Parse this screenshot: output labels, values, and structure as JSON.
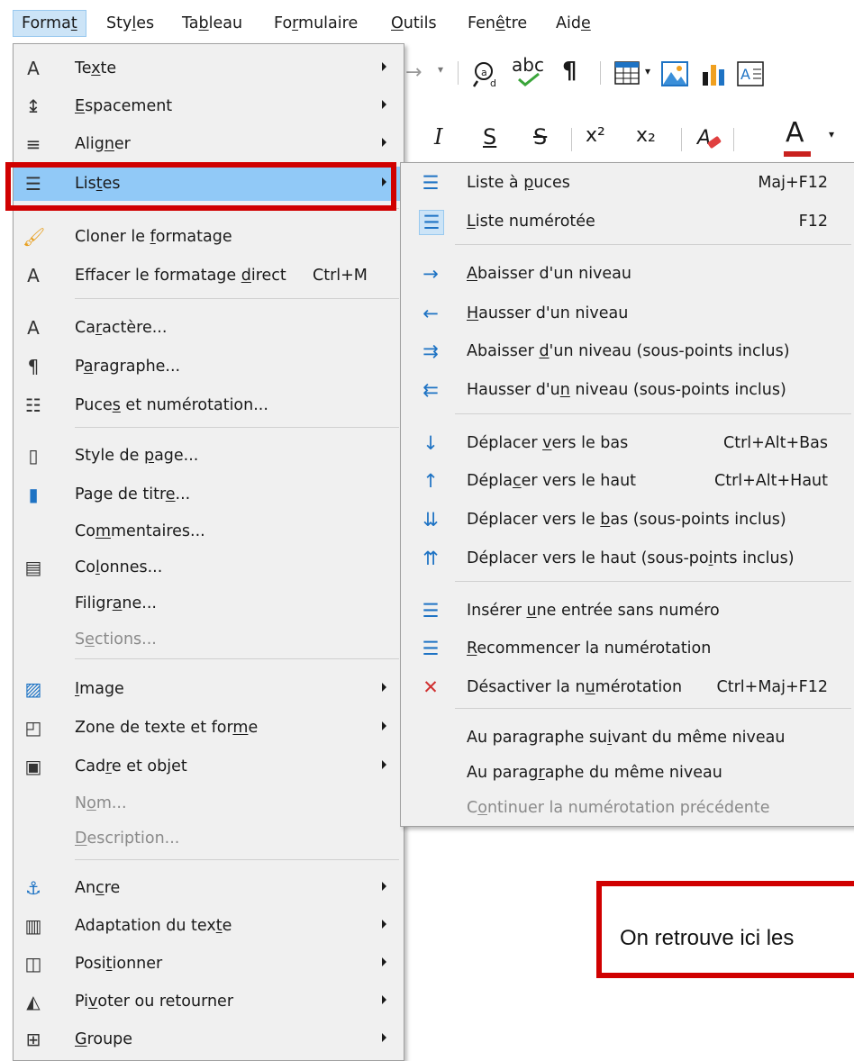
{
  "menubar": {
    "items": [
      {
        "label": "Format",
        "u": 5
      },
      {
        "label": "Styles",
        "u": 3
      },
      {
        "label": "Tableau",
        "u": 2
      },
      {
        "label": "Formulaire",
        "u": 2
      },
      {
        "label": "Outils",
        "u": 0
      },
      {
        "label": "Fenêtre",
        "u": 3
      },
      {
        "label": "Aide",
        "u": 3
      }
    ]
  },
  "toolbar": {
    "row1": [
      "redo-arrow-icon",
      "find-replace-icon",
      "spellcheck-icon",
      "pilcrow-icon",
      "table-icon",
      "image-icon",
      "chart-icon",
      "textbox-icon"
    ],
    "spell_label": "abc",
    "row2": [
      "italic-icon",
      "underline-icon",
      "strikethrough-icon",
      "superscript-icon",
      "subscript-icon",
      "clear-format-icon",
      "font-color-icon"
    ],
    "italic": "I",
    "underline": "S",
    "strike": "S",
    "superscript": "x²",
    "subscript": "x₂",
    "font_color": "A"
  },
  "format_menu": {
    "items": [
      {
        "label": "Texte",
        "u": 2,
        "icon": "text-icon",
        "submenu": true
      },
      {
        "label": "Espacement",
        "u": 0,
        "icon": "spacing-icon",
        "submenu": true
      },
      {
        "label": "Aligner",
        "u": 4,
        "icon": "align-icon",
        "submenu": true
      },
      {
        "label": "Listes",
        "u": 3,
        "icon": "lists-icon",
        "submenu": true,
        "highlighted": true
      },
      {
        "label": "Cloner le formatage",
        "u": 10,
        "icon": "clone-formatting-icon"
      },
      {
        "label": "Effacer le formatage direct",
        "u": 21,
        "icon": "clear-direct-formatting-icon",
        "shortcut": "Ctrl+M"
      },
      {
        "label": "Caractère...",
        "u": 2,
        "icon": "character-icon"
      },
      {
        "label": "Paragraphe...",
        "u": 1,
        "icon": "paragraph-icon"
      },
      {
        "label": "Puces et numérotation...",
        "u": 4,
        "icon": "bullets-numbering-icon"
      },
      {
        "label": "Style de page...",
        "u": 9,
        "icon": "page-style-icon"
      },
      {
        "label": "Page de titre...",
        "u": 12,
        "icon": "title-page-icon"
      },
      {
        "label": "Commentaires...",
        "u": 2,
        "icon": ""
      },
      {
        "label": "Colonnes...",
        "u": 2,
        "icon": "columns-icon"
      },
      {
        "label": "Filigrane...",
        "u": 6,
        "icon": ""
      },
      {
        "label": "Sections...",
        "u": 1,
        "icon": "",
        "disabled": true
      },
      {
        "label": "Image",
        "u": 0,
        "icon": "image-icon",
        "submenu": true
      },
      {
        "label": "Zone de texte et forme",
        "u": 20,
        "icon": "text-box-shape-icon",
        "submenu": true
      },
      {
        "label": "Cadre et objet",
        "u": 3,
        "icon": "frame-object-icon",
        "submenu": true
      },
      {
        "label": "Nom...",
        "u": 1,
        "icon": "",
        "disabled": true
      },
      {
        "label": "Description...",
        "u": 0,
        "icon": "",
        "disabled": true
      },
      {
        "label": "Ancre",
        "u": 2,
        "icon": "anchor-icon",
        "submenu": true
      },
      {
        "label": "Adaptation du texte",
        "u": 17,
        "icon": "text-wrap-icon",
        "submenu": true
      },
      {
        "label": "Positionner",
        "u": 4,
        "icon": "arrange-icon",
        "submenu": true
      },
      {
        "label": "Pivoter ou retourner",
        "u": 2,
        "icon": "rotate-flip-icon",
        "submenu": true
      },
      {
        "label": "Groupe",
        "u": 0,
        "icon": "group-icon",
        "submenu": true
      }
    ]
  },
  "listes_submenu": {
    "items": [
      {
        "label": "Liste à puces",
        "u": 8,
        "icon": "bullet-list-icon",
        "shortcut": "Maj+F12"
      },
      {
        "label": "Liste numérotée",
        "u": 0,
        "icon": "numbered-list-icon",
        "shortcut": "F12"
      },
      {
        "label": "Abaisser d'un niveau",
        "u": 0,
        "icon": "arrow-right-icon"
      },
      {
        "label": "Hausser d'un niveau",
        "u": 0,
        "icon": "arrow-left-icon"
      },
      {
        "label": "Abaisser d'un niveau (sous-points inclus)",
        "u": 9,
        "icon": "arrow-right-double-icon"
      },
      {
        "label": "Hausser d'un niveau (sous-points inclus)",
        "u": 11,
        "icon": "arrow-left-double-icon"
      },
      {
        "label": "Déplacer vers le bas",
        "u": 9,
        "icon": "arrow-down-icon",
        "shortcut": "Ctrl+Alt+Bas"
      },
      {
        "label": "Déplacer vers le haut",
        "u": 5,
        "icon": "arrow-up-icon",
        "shortcut": "Ctrl+Alt+Haut"
      },
      {
        "label": "Déplacer vers le bas (sous-points inclus)",
        "u": 17,
        "icon": "arrow-down-double-icon"
      },
      {
        "label": "Déplacer vers le haut (sous-points inclus)",
        "u": 30,
        "icon": "arrow-up-double-icon"
      },
      {
        "label": "Insérer une entrée sans numéro",
        "u": 8,
        "icon": "no-number-entry-icon"
      },
      {
        "label": "Recommencer la numérotation",
        "u": 0,
        "icon": "restart-numbering-icon"
      },
      {
        "label": "Désactiver la numérotation",
        "u": 15,
        "icon": "no-list-icon",
        "shortcut": "Ctrl+Maj+F12"
      },
      {
        "label": "Au paragraphe suivant du même niveau",
        "u": 16,
        "icon": ""
      },
      {
        "label": "Au paragraphe du même niveau",
        "u": 8,
        "icon": ""
      },
      {
        "label": "Continuer la numérotation précédente",
        "u": 1,
        "icon": "",
        "disabled": true
      }
    ]
  },
  "callout": {
    "text": "On retrouve ici les"
  }
}
